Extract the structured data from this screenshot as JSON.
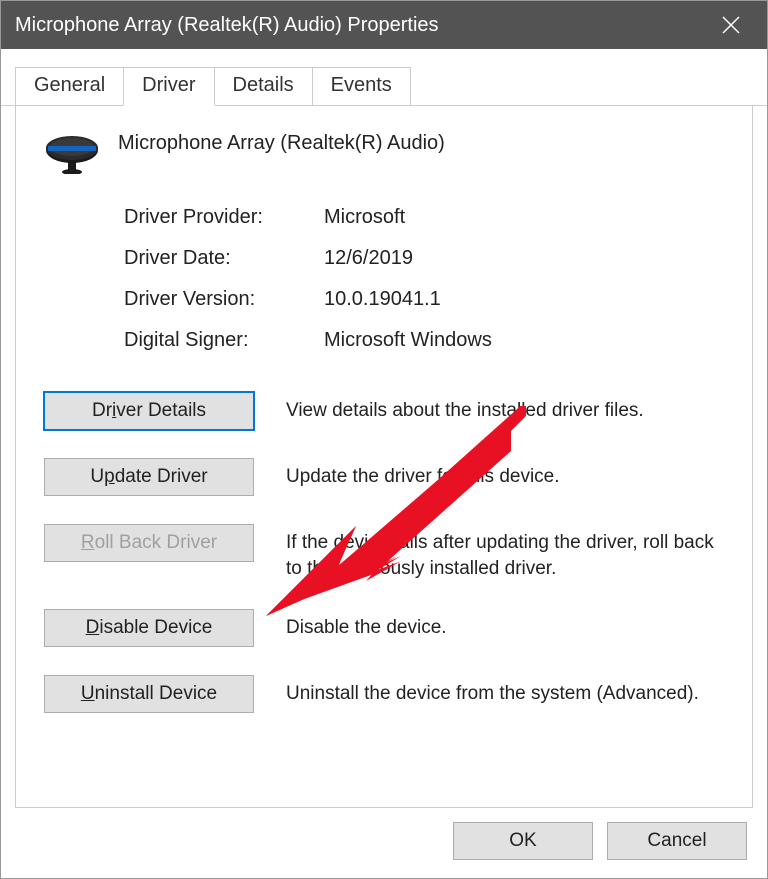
{
  "window": {
    "title": "Microphone Array (Realtek(R) Audio) Properties"
  },
  "tabs": {
    "general": "General",
    "driver": "Driver",
    "details": "Details",
    "events": "Events",
    "active": "driver"
  },
  "device": {
    "name": "Microphone Array (Realtek(R) Audio)"
  },
  "info": {
    "provider_label": "Driver Provider:",
    "provider_value": "Microsoft",
    "date_label": "Driver Date:",
    "date_value": "12/6/2019",
    "version_label": "Driver Version:",
    "version_value": "10.0.19041.1",
    "signer_label": "Digital Signer:",
    "signer_value": "Microsoft Windows"
  },
  "actions": {
    "details": {
      "prefix": "Dr",
      "mnemonic": "i",
      "suffix": "ver Details",
      "desc": "View details about the installed driver files."
    },
    "update": {
      "prefix": "U",
      "mnemonic": "p",
      "suffix": "date Driver",
      "desc": "Update the driver for this device."
    },
    "rollback": {
      "prefix": "",
      "mnemonic": "R",
      "suffix": "oll Back Driver",
      "desc": "If the device fails after updating the driver, roll back to the previously installed driver."
    },
    "disable": {
      "prefix": "",
      "mnemonic": "D",
      "suffix": "isable Device",
      "desc": "Disable the device."
    },
    "uninstall": {
      "prefix": "",
      "mnemonic": "U",
      "suffix": "ninstall Device",
      "desc": "Uninstall the device from the system (Advanced)."
    }
  },
  "footer": {
    "ok": "OK",
    "cancel": "Cancel"
  }
}
